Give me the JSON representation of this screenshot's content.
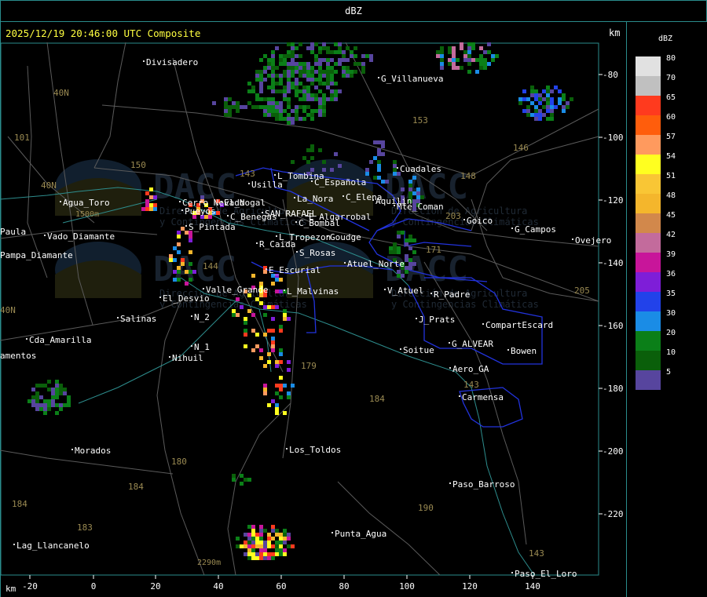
{
  "window_title": "dBZ",
  "timestamp": "2025/12/19 20:46:00 UTC Composite",
  "axis_unit_label": "km",
  "legend": {
    "title": "dBZ",
    "items": [
      {
        "value": "80",
        "color": "#e1e1e1"
      },
      {
        "value": "70",
        "color": "#c0c0c0"
      },
      {
        "value": "65",
        "color": "#ff3a1e"
      },
      {
        "value": "60",
        "color": "#ff5d0c"
      },
      {
        "value": "57",
        "color": "#ff9a5e"
      },
      {
        "value": "54",
        "color": "#ffff20"
      },
      {
        "value": "51",
        "color": "#f9c635"
      },
      {
        "value": "48",
        "color": "#f4b62c"
      },
      {
        "value": "45",
        "color": "#d2884b"
      },
      {
        "value": "42",
        "color": "#c36b9c"
      },
      {
        "value": "39",
        "color": "#c8159a"
      },
      {
        "value": "36",
        "color": "#7e1ed8"
      },
      {
        "value": "35",
        "color": "#2242ea"
      },
      {
        "value": "30",
        "color": "#1a8ce6"
      },
      {
        "value": "20",
        "color": "#0b7f18"
      },
      {
        "value": "10",
        "color": "#0a5f0a"
      },
      {
        "value": "5",
        "color": "#57459e"
      }
    ]
  },
  "axes": {
    "x_ticks": [
      "-20",
      "0",
      "20",
      "40",
      "60",
      "80",
      "100",
      "120",
      "140"
    ],
    "y_ticks": [
      "-80",
      "-100",
      "-120",
      "-140",
      "-160",
      "-180",
      "-200",
      "-220"
    ]
  },
  "watermark": {
    "brand": "DACC",
    "line1": "Dirección de Agricultura",
    "line2": "y Contingencias Climáticas"
  },
  "places": [
    {
      "name": "Divisadero"
    },
    {
      "name": "G_Villanueva"
    },
    {
      "name": "Usilla"
    },
    {
      "name": "L_Tombina"
    },
    {
      "name": "C_Española"
    },
    {
      "name": "La_Nora"
    },
    {
      "name": "C_Elena"
    },
    {
      "name": "Cuadales"
    },
    {
      "name": "Aquilin"
    },
    {
      "name": "Mte_Coman"
    },
    {
      "name": "Agua_Toro"
    },
    {
      "name": "Cerro_Nevado"
    },
    {
      "name": "C_Benegas"
    },
    {
      "name": "SAN_RAFAEL"
    },
    {
      "name": "E_Algarrobal"
    },
    {
      "name": "Goudge"
    },
    {
      "name": "Goico"
    },
    {
      "name": "G_Campos"
    },
    {
      "name": "C_Bombal"
    },
    {
      "name": "L_Tropezon"
    },
    {
      "name": "S_Pintada"
    },
    {
      "name": "R_Caida"
    },
    {
      "name": "S_Rosas"
    },
    {
      "name": "Atuel_Norte"
    },
    {
      "name": "Valle_Grande"
    },
    {
      "name": "E_Escurial"
    },
    {
      "name": "L_Malvinas"
    },
    {
      "name": "V_Atuel"
    },
    {
      "name": "R_Padre"
    },
    {
      "name": "El_Desvio"
    },
    {
      "name": "Salinas"
    },
    {
      "name": "N_2"
    },
    {
      "name": "N_1"
    },
    {
      "name": "Nihuil"
    },
    {
      "name": "J_Prats"
    },
    {
      "name": "CompartEscard"
    },
    {
      "name": "G_ALVEAR"
    },
    {
      "name": "Soitue"
    },
    {
      "name": "Bowen"
    },
    {
      "name": "Aero_GA"
    },
    {
      "name": "Carmensa"
    },
    {
      "name": "Cda_Amarilla"
    },
    {
      "name": "Morados"
    },
    {
      "name": "Los_Toldos"
    },
    {
      "name": "Paso_Barroso"
    },
    {
      "name": "Punta_Agua"
    },
    {
      "name": "Lag_Llancanelo"
    },
    {
      "name": "Paso_El_Loro"
    },
    {
      "name": "Pampa_Diamante"
    },
    {
      "name": "Vado_Diamante"
    },
    {
      "name": "Paula"
    },
    {
      "name": "Ovejero"
    },
    {
      "name": "amentos"
    },
    {
      "name": "Pueyos"
    },
    {
      "name": "El_Nogal"
    }
  ],
  "route_numbers": [
    "40N",
    "40N",
    "101",
    "153",
    "146",
    "148",
    "203",
    "150",
    "171",
    "184",
    "179",
    "180",
    "184",
    "184",
    "183",
    "190",
    "143",
    "205",
    "143",
    "144",
    "40N",
    "143"
  ],
  "elevations": [
    "1500m",
    "2290m"
  ]
}
